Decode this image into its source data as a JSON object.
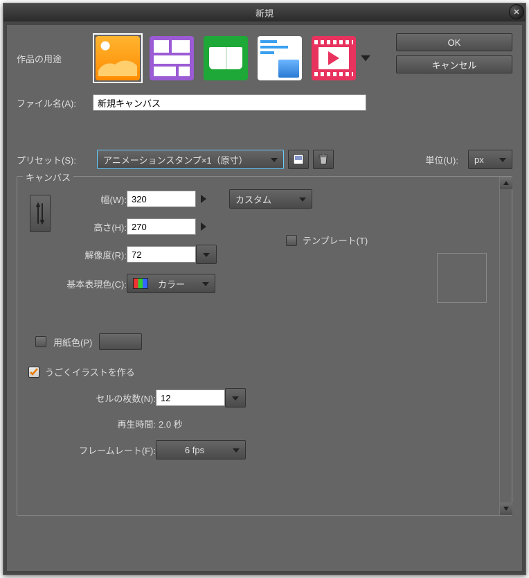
{
  "title": "新規",
  "buttons": {
    "ok": "OK",
    "cancel": "キャンセル"
  },
  "purpose": {
    "label": "作品の用途"
  },
  "file": {
    "label": "ファイル名(A):",
    "value": "新規キャンバス"
  },
  "preset": {
    "label": "プリセット(S):",
    "value": "アニメーションスタンプ×1（原寸）",
    "unit_label": "単位(U):",
    "unit_value": "px"
  },
  "canvas": {
    "legend": "キャンバス",
    "width_label": "幅(W):",
    "width_value": "320",
    "height_label": "高さ(H):",
    "height_value": "270",
    "size_preset": "カスタム",
    "resolution_label": "解像度(R):",
    "resolution_value": "72",
    "color_label": "基本表現色(C):",
    "color_value": "カラー",
    "template_label": "テンプレート(T)",
    "paper_label": "用紙色(P)"
  },
  "anim": {
    "make_label": "うごくイラストを作る",
    "cells_label": "セルの枚数(N):",
    "cells_value": "12",
    "duration_label": "再生時間:",
    "duration_value": "2.0 秒",
    "fps_label": "フレームレート(F):",
    "fps_value": "6 fps"
  }
}
